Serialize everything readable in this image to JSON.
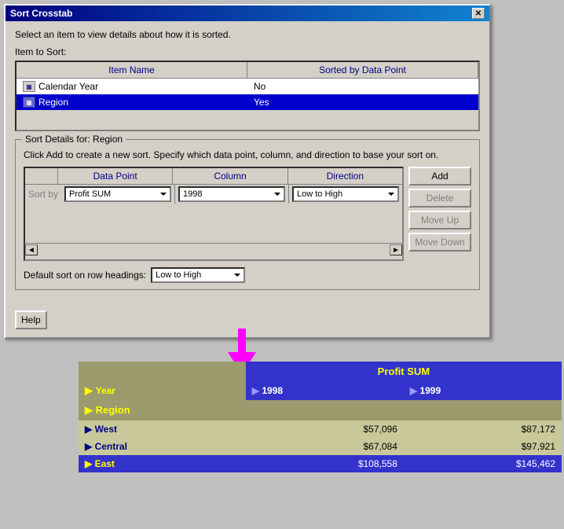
{
  "dialog": {
    "title": "Sort Crosstab",
    "description": "Select an item to view details about how it is sorted.",
    "item_to_sort_label": "Item to Sort:",
    "columns": {
      "item_name": "Item Name",
      "sorted_by": "Sorted by Data Point"
    },
    "items": [
      {
        "name": "Calendar Year",
        "sorted": "No",
        "selected": false
      },
      {
        "name": "Region",
        "sorted": "Yes",
        "selected": true
      }
    ],
    "sort_details": {
      "legend": "Sort Details for: Region",
      "description": "Click Add to create a new sort. Specify which data point, column, and direction to base your sort on.",
      "grid_headers": {
        "data_point": "Data Point",
        "column": "Column",
        "direction": "Direction"
      },
      "sort_by_label": "Sort by",
      "row": {
        "data_point": "Profit SUM",
        "column": "1998",
        "direction": "Low to High"
      },
      "buttons": {
        "add": "Add",
        "delete": "Delete",
        "move_up": "Move Up",
        "move_down": "Move Down"
      },
      "default_sort_label": "Default sort on row headings:",
      "default_sort_value": "Low to High"
    }
  },
  "footer": {
    "help_button": "Help"
  },
  "crosstab": {
    "profit_sum_label": "Profit SUM",
    "year_label": "Year",
    "years": [
      "1998",
      "1999"
    ],
    "region_label": "Region",
    "rows": [
      {
        "name": "West",
        "values": [
          "$57,096",
          "$87,172"
        ],
        "selected": false
      },
      {
        "name": "Central",
        "values": [
          "$67,084",
          "$97,921"
        ],
        "selected": false
      },
      {
        "name": "East",
        "values": [
          "$108,558",
          "$145,462"
        ],
        "selected": true
      }
    ]
  }
}
